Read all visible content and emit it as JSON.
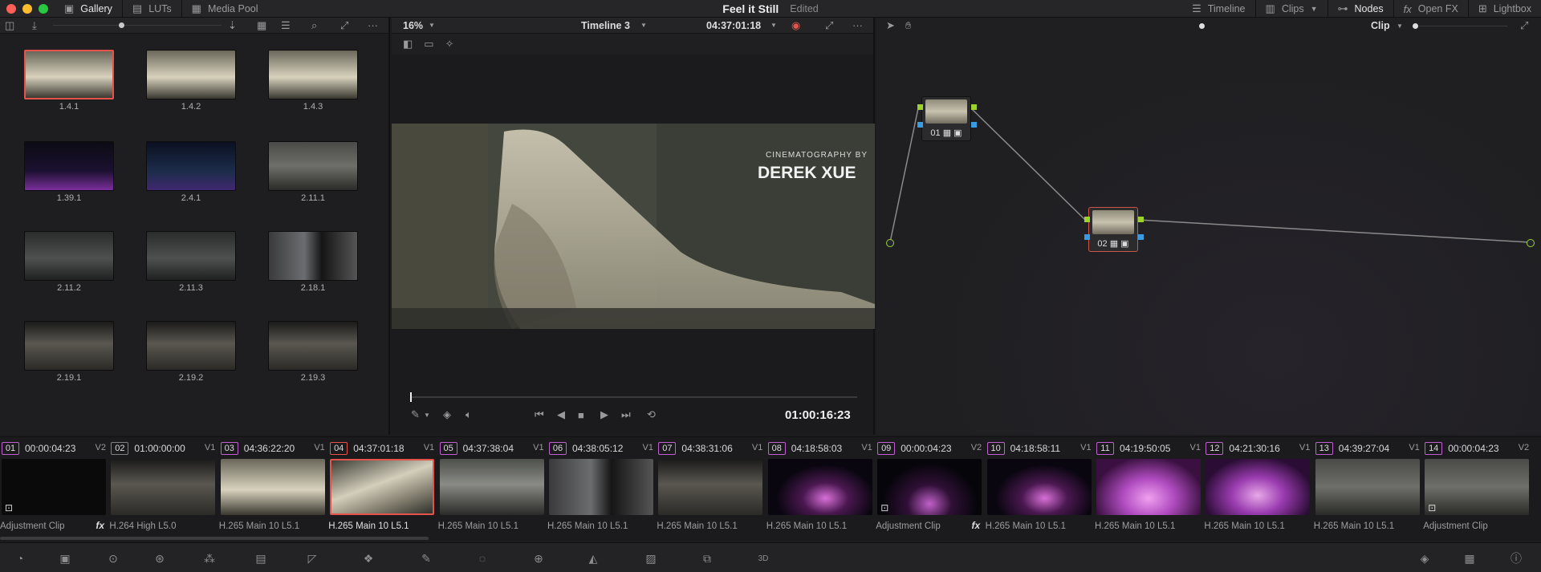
{
  "topbar": {
    "tabs": [
      {
        "label": "Gallery",
        "icon": "gallery-icon"
      },
      {
        "label": "LUTs",
        "icon": "luts-icon"
      },
      {
        "label": "Media Pool",
        "icon": "media-pool-icon"
      }
    ],
    "project_title": "Feel it Still",
    "project_status": "Edited",
    "right_tabs": [
      {
        "label": "Timeline",
        "icon": "timeline-icon"
      },
      {
        "label": "Clips",
        "icon": "clips-icon"
      },
      {
        "label": "Nodes",
        "icon": "nodes-icon"
      },
      {
        "label": "Open FX",
        "icon": "fx-icon"
      },
      {
        "label": "Lightbox",
        "icon": "lightbox-icon"
      }
    ]
  },
  "gallery": {
    "stills": [
      {
        "label": "1.4.1",
        "selected": true,
        "tone": "cream"
      },
      {
        "label": "1.4.2",
        "selected": false,
        "tone": "cream"
      },
      {
        "label": "1.4.3",
        "selected": false,
        "tone": "cream"
      },
      {
        "label": "1.39.1",
        "selected": false,
        "tone": "purple"
      },
      {
        "label": "2.4.1",
        "selected": false,
        "tone": "blue"
      },
      {
        "label": "2.11.1",
        "selected": false,
        "tone": "grey"
      },
      {
        "label": "2.11.2",
        "selected": false,
        "tone": "dark"
      },
      {
        "label": "2.11.3",
        "selected": false,
        "tone": "dark"
      },
      {
        "label": "2.18.1",
        "selected": false,
        "tone": "portrait"
      },
      {
        "label": "2.19.1",
        "selected": false,
        "tone": "studio"
      },
      {
        "label": "2.19.2",
        "selected": false,
        "tone": "studio"
      },
      {
        "label": "2.19.3",
        "selected": false,
        "tone": "studio"
      }
    ]
  },
  "viewer": {
    "zoom": "16%",
    "timeline_name": "Timeline 3",
    "timecode_top": "04:37:01:18",
    "overlay_small": "CINEMATOGRAPHY BY",
    "overlay_big": "DEREK XUE",
    "timecode_bottom": "01:00:16:23"
  },
  "nodes_panel": {
    "mode": "Clip",
    "nodes": [
      {
        "label": "01",
        "selected": false
      },
      {
        "label": "02",
        "selected": true
      }
    ]
  },
  "clips": [
    {
      "num": "01",
      "tc": "00:00:04:23",
      "track": "V2",
      "codec": "Adjustment Clip",
      "fx": true,
      "tone": "black",
      "accent": "#c060d0"
    },
    {
      "num": "02",
      "tc": "01:00:00:00",
      "track": "V1",
      "codec": "H.264 High L5.0",
      "fx": false,
      "tone": "studio",
      "accent": "#808080"
    },
    {
      "num": "03",
      "tc": "04:36:22:20",
      "track": "V1",
      "codec": "H.265 Main 10 L5.1",
      "fx": false,
      "tone": "cream",
      "accent": "#c060d0"
    },
    {
      "num": "04",
      "tc": "04:37:01:18",
      "track": "V1",
      "codec": "H.265 Main 10 L5.1",
      "fx": false,
      "tone": "shoe",
      "accent": "#e5534b",
      "selected": true
    },
    {
      "num": "05",
      "tc": "04:37:38:04",
      "track": "V1",
      "codec": "H.265 Main 10 L5.1",
      "fx": false,
      "tone": "laptop",
      "accent": "#c060d0"
    },
    {
      "num": "06",
      "tc": "04:38:05:12",
      "track": "V1",
      "codec": "H.265 Main 10 L5.1",
      "fx": false,
      "tone": "portrait",
      "accent": "#c060d0"
    },
    {
      "num": "07",
      "tc": "04:38:31:06",
      "track": "V1",
      "codec": "H.265 Main 10 L5.1",
      "fx": false,
      "tone": "studio",
      "accent": "#c060d0"
    },
    {
      "num": "08",
      "tc": "04:18:58:03",
      "track": "V1",
      "codec": "H.265 Main 10 L5.1",
      "fx": false,
      "tone": "pink",
      "accent": "#c060d0"
    },
    {
      "num": "09",
      "tc": "00:00:04:23",
      "track": "V2",
      "codec": "Adjustment Clip",
      "fx": true,
      "tone": "pinkdark",
      "accent": "#c060d0"
    },
    {
      "num": "10",
      "tc": "04:18:58:11",
      "track": "V1",
      "codec": "H.265 Main 10 L5.1",
      "fx": false,
      "tone": "pink",
      "accent": "#c060d0"
    },
    {
      "num": "11",
      "tc": "04:19:50:05",
      "track": "V1",
      "codec": "H.265 Main 10 L5.1",
      "fx": false,
      "tone": "pinkbright",
      "accent": "#c060d0"
    },
    {
      "num": "12",
      "tc": "04:21:30:16",
      "track": "V1",
      "codec": "H.265 Main 10 L5.1",
      "fx": false,
      "tone": "pinktable",
      "accent": "#c060d0"
    },
    {
      "num": "13",
      "tc": "04:39:27:04",
      "track": "V1",
      "codec": "H.265 Main 10 L5.1",
      "fx": false,
      "tone": "grey",
      "accent": "#c060d0"
    },
    {
      "num": "14",
      "tc": "00:00:04:23",
      "track": "V2",
      "codec": "Adjustment Clip",
      "fx": false,
      "tone": "grey",
      "accent": "#c060d0"
    }
  ],
  "colors": {
    "accent_red": "#e5534b",
    "node_green": "#9bd22b",
    "node_blue": "#3b9be0"
  }
}
